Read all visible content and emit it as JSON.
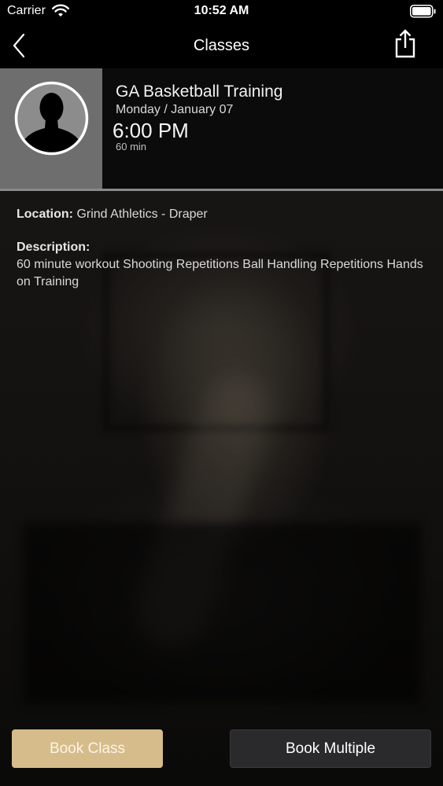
{
  "status_bar": {
    "carrier": "Carrier",
    "time": "10:52 AM"
  },
  "nav": {
    "title": "Classes"
  },
  "class_info": {
    "name": "GA Basketball Training",
    "date": "Monday / January 07",
    "time": "6:00 PM",
    "duration": "60 min"
  },
  "details": {
    "location_label": "Location:",
    "location_value": "Grind Athletics - Draper",
    "description_label": "Description:",
    "description_text": "60 minute workout Shooting Repetitions Ball Handling Repetitions Hands on Training"
  },
  "buttons": {
    "book_class": "Book Class",
    "book_multiple": "Book Multiple"
  },
  "colors": {
    "book_class_bg": "#d6bc8a",
    "book_multiple_bg": "#2a2a2c",
    "avatar_panel_bg": "#6e6e6e"
  },
  "icons": {
    "wifi": "wifi-icon",
    "battery": "battery-icon",
    "back": "chevron-left-icon",
    "share": "share-icon",
    "avatar": "person-silhouette-icon"
  }
}
